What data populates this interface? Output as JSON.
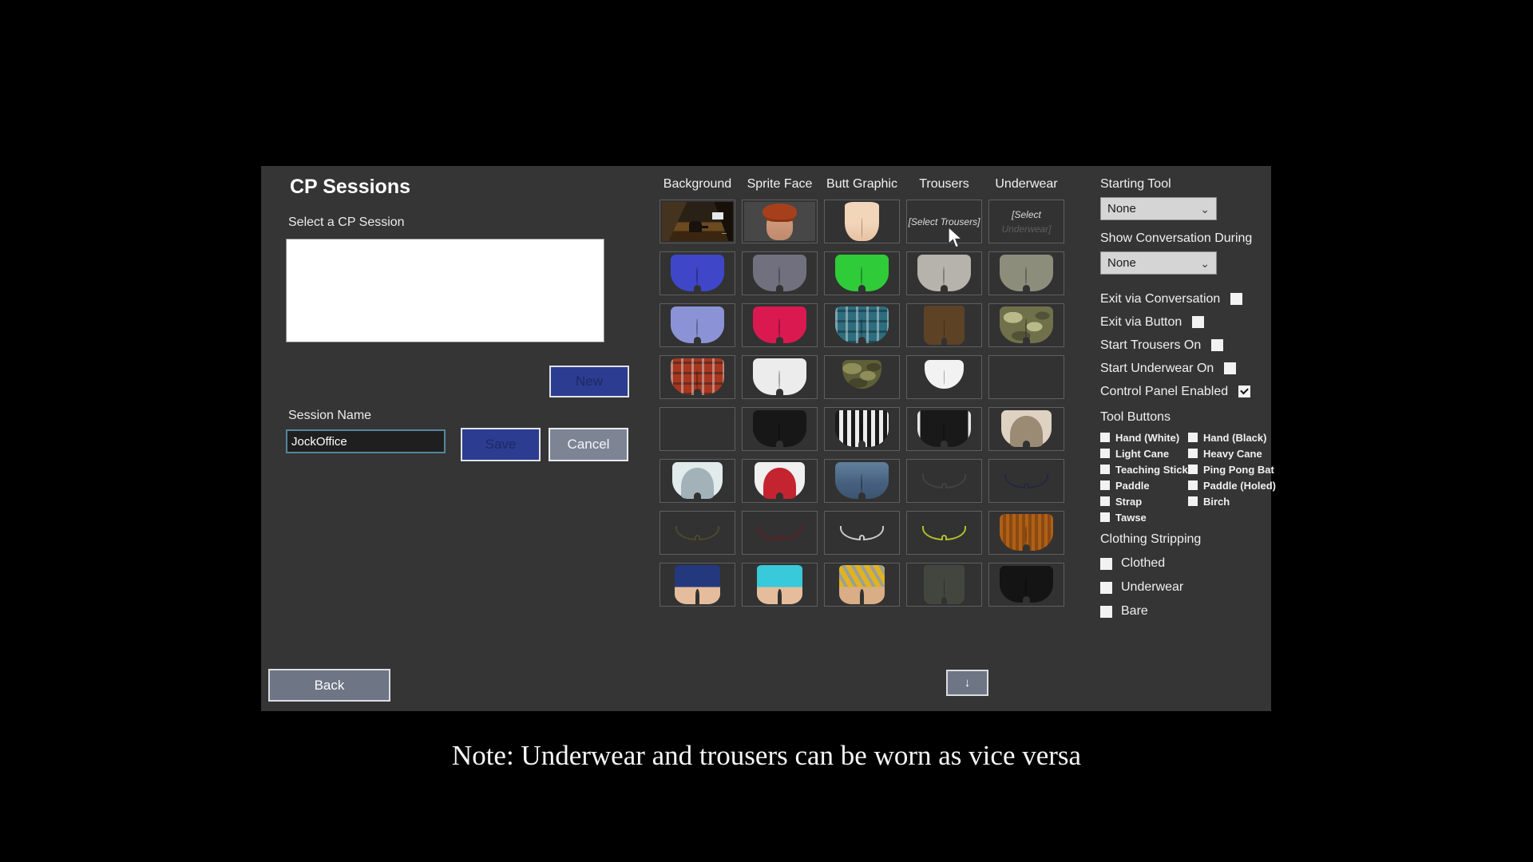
{
  "window": {
    "title": "CP Sessions"
  },
  "session_panel": {
    "select_label": "Select a CP Session",
    "new_button": "New",
    "session_name_label": "Session Name",
    "session_name_value": "JockOffice",
    "save_button": "Save",
    "cancel_button": "Cancel",
    "back_button": "Back",
    "scroll_down_button": "↓"
  },
  "grid": {
    "headers": [
      "Background",
      "Sprite Face",
      "Butt Graphic",
      "Trousers",
      "Underwear"
    ],
    "rows": [
      [
        {
          "kind": "thumb",
          "style": "scene",
          "name": "office-background-thumbnail"
        },
        {
          "kind": "thumb",
          "style": "face",
          "name": "sprite-face-thumbnail"
        },
        {
          "kind": "thumb",
          "style": "bare",
          "name": "bare-butt-thumbnail"
        },
        {
          "kind": "text",
          "line1": "[Select Trousers]",
          "line2": ""
        },
        {
          "kind": "text",
          "line1": "[Select",
          "line2": "Underwear]"
        }
      ],
      [
        {
          "kind": "thumb",
          "style": "shorts",
          "name": "blue-boxers-thumbnail",
          "c1": "#3f47c8"
        },
        {
          "kind": "thumb",
          "style": "shorts",
          "name": "gray-boxers-thumbnail",
          "c1": "#70707e"
        },
        {
          "kind": "thumb",
          "style": "shorts",
          "name": "green-boxers-thumbnail",
          "c1": "#2fcb39"
        },
        {
          "kind": "thumb",
          "style": "shorts",
          "name": "light-gray-boxers-thumbnail",
          "c1": "#b6b2ac"
        },
        {
          "kind": "thumb",
          "style": "shorts",
          "name": "olive-boxers-thumbnail",
          "c1": "#8d8d7c"
        }
      ],
      [
        {
          "kind": "thumb",
          "style": "shorts",
          "name": "periwinkle-boxers-thumbnail",
          "c1": "#8b93d6"
        },
        {
          "kind": "thumb",
          "style": "shorts",
          "name": "red-boxers-thumbnail",
          "c1": "#da1950"
        },
        {
          "kind": "thumb",
          "style": "plaid",
          "name": "teal-plaid-boxers-thumbnail",
          "c1": "#2e6d7e"
        },
        {
          "kind": "thumb",
          "style": "pants",
          "name": "brown-trousers-thumbnail",
          "c1": "#5d4226"
        },
        {
          "kind": "thumb",
          "style": "camo",
          "name": "camo-shorts-thumbnail",
          "c1": "#70714a",
          "c2": "#b9ba8a"
        }
      ],
      [
        {
          "kind": "thumb",
          "style": "plaid",
          "name": "red-plaid-boxers-thumbnail",
          "c1": "#a8371f"
        },
        {
          "kind": "thumb",
          "style": "shorts",
          "name": "white-shorts-thumbnail",
          "c1": "#ececec"
        },
        {
          "kind": "thumb",
          "style": "camo-briefs",
          "name": "camo-briefs-thumbnail",
          "c1": "#5e5f39",
          "c2": "#8d8e5a"
        },
        {
          "kind": "thumb",
          "style": "briefs",
          "name": "white-briefs-thumbnail",
          "c1": "#f2f2f2"
        },
        {
          "kind": "empty"
        }
      ],
      [
        {
          "kind": "empty"
        },
        {
          "kind": "thumb",
          "style": "shorts",
          "name": "black-shorts-thumbnail",
          "c1": "#171717"
        },
        {
          "kind": "thumb",
          "style": "zebra",
          "name": "zebra-stripe-shorts-thumbnail",
          "c1": "#1a1a1a"
        },
        {
          "kind": "thumb",
          "style": "sidestripe",
          "name": "black-track-trousers-thumbnail",
          "c1": "#191919"
        },
        {
          "kind": "thumb",
          "style": "arch",
          "name": "cream-jock-thumbnail",
          "c1": "#ded2c2",
          "c2": "#9b8a74"
        }
      ],
      [
        {
          "kind": "thumb",
          "style": "arch",
          "name": "pale-blue-shorts-thumbnail",
          "c1": "#e2ebec",
          "c2": "#a2b2b8"
        },
        {
          "kind": "thumb",
          "style": "arch",
          "name": "red-white-shorts-thumbnail",
          "c1": "#f0f0f0",
          "c2": "#c42430"
        },
        {
          "kind": "thumb",
          "style": "denim",
          "name": "denim-jeans-thumbnail",
          "c1": "#4c6a88"
        },
        {
          "kind": "thumb",
          "style": "outline",
          "name": "dark-briefs-outline-thumbnail",
          "c1": "#424242"
        },
        {
          "kind": "thumb",
          "style": "outline",
          "name": "navy-briefs-outline-thumbnail",
          "c1": "#262640"
        }
      ],
      [
        {
          "kind": "thumb",
          "style": "outline",
          "name": "olive-briefs-outline-thumbnail",
          "c1": "#4a4a30"
        },
        {
          "kind": "thumb",
          "style": "outline",
          "name": "dark-red-briefs-outline-thumbnail",
          "c1": "#5e2026"
        },
        {
          "kind": "thumb",
          "style": "outline",
          "name": "light-briefs-outline-thumbnail",
          "c1": "#cbcbcb"
        },
        {
          "kind": "thumb",
          "style": "outline",
          "name": "yellow-green-briefs-outline-thumbnail",
          "c1": "#b4be2c"
        },
        {
          "kind": "thumb",
          "style": "cord",
          "name": "corduroy-trousers-thumbnail",
          "c1": "#a85a16"
        }
      ],
      [
        {
          "kind": "thumb",
          "style": "jock",
          "name": "navy-jock-thumbnail",
          "c1": "#24387e",
          "skin": "#e5bd9c"
        },
        {
          "kind": "thumb",
          "style": "jock",
          "name": "cyan-briefs-thumbnail",
          "c1": "#38c9da",
          "skin": "#e5bd9c"
        },
        {
          "kind": "thumb",
          "style": "jock straps",
          "name": "yellow-strapped-briefs-thumbnail",
          "c1": "#e0b322",
          "skin": "#d9ad85"
        },
        {
          "kind": "thumb",
          "style": "pants",
          "name": "gray-trousers-thumbnail",
          "c1": "#43453f"
        },
        {
          "kind": "thumb",
          "style": "shorts",
          "name": "black-long-shorts-thumbnail",
          "c1": "#141414"
        }
      ]
    ]
  },
  "options": {
    "starting_tool_label": "Starting Tool",
    "starting_tool_value": "None",
    "show_conversation_label": "Show Conversation During",
    "show_conversation_value": "None",
    "dropdown_caret": "⌄",
    "checkboxes": [
      {
        "label": "Exit via Conversation",
        "checked": false
      },
      {
        "label": "Exit via Button",
        "checked": false
      },
      {
        "label": "Start Trousers On",
        "checked": false
      },
      {
        "label": "Start Underwear On",
        "checked": false
      },
      {
        "label": "Control Panel Enabled",
        "checked": true
      }
    ],
    "tool_buttons": {
      "heading": "Tool Buttons",
      "left": [
        "Hand (White)",
        "Light Cane",
        "Teaching Stick",
        "Paddle",
        "Strap",
        "Tawse"
      ],
      "right": [
        "Hand (Black)",
        "Heavy Cane",
        "Ping Pong Bat",
        "Paddle (Holed)",
        "Birch"
      ]
    },
    "clothing_stripping": {
      "heading": "Clothing Stripping",
      "items": [
        "Clothed",
        "Underwear",
        "Bare"
      ]
    }
  },
  "note": "Note: Underwear and trousers can be worn as vice versa",
  "colors": {
    "panel_bg": "#353535",
    "accent_blue_button": "#2c3c90",
    "gray_button": "#7d8595",
    "input_border": "#55869e"
  }
}
